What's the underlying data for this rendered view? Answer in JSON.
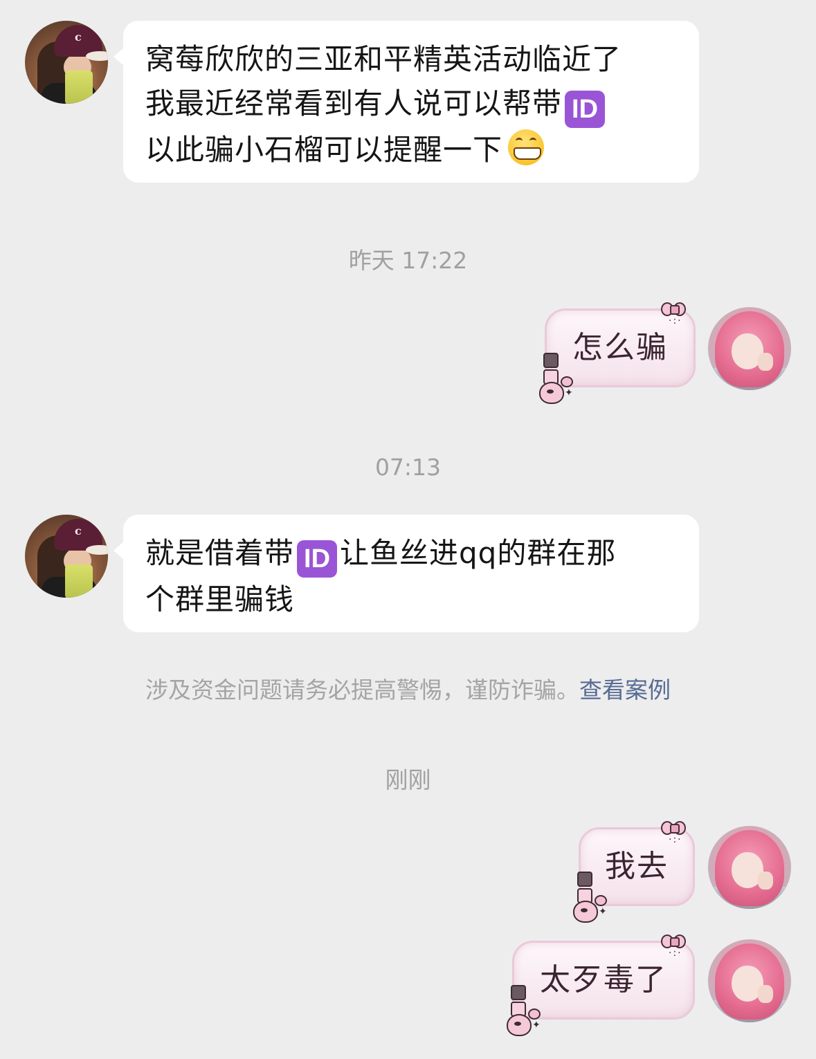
{
  "messages": [
    {
      "side": "left",
      "lines": [
        "窝莓欣欣的三亚和平精英活动临近了",
        "我最近经常看到有人说可以帮带",
        "以此骗小石榴可以提醒一下"
      ],
      "emoji": [
        "id-button-emoji",
        "grinning-face-emoji"
      ]
    },
    {
      "type": "time",
      "text": "昨天 17:22"
    },
    {
      "side": "right",
      "text": "怎么骗"
    },
    {
      "type": "time",
      "text": "07:13"
    },
    {
      "side": "left",
      "lines": [
        "就是借着带",
        "让鱼丝进qq的群在那",
        "个群里骗钱"
      ],
      "emoji": [
        "id-button-emoji"
      ]
    },
    {
      "side": "right",
      "text": "我去"
    },
    {
      "side": "right",
      "text": "太歹毒了"
    }
  ],
  "notice": {
    "text": "涉及资金问题请务必提高警惕，谨防诈骗。",
    "link": "查看案例"
  },
  "time_just_now": "刚刚",
  "emoji_id_label": "ID",
  "colors": {
    "background": "#ededed",
    "incoming_bubble": "#ffffff",
    "outgoing_bubble": "#f7e8ef",
    "outgoing_border": "#eac9d8",
    "id_emoji": "#9a55d6",
    "link": "#576b95",
    "timestamp": "#a0a0a0"
  }
}
